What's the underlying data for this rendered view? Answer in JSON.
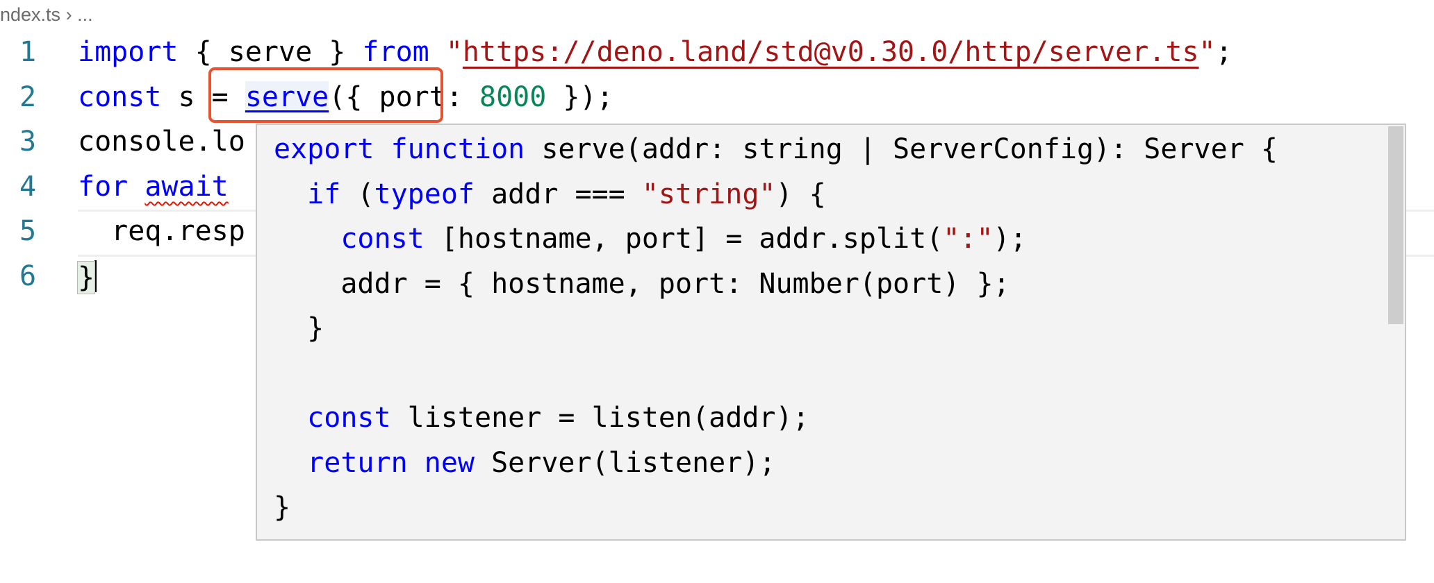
{
  "breadcrumb": {
    "file": "ndex.ts",
    "separator": "›",
    "more": "..."
  },
  "editor": {
    "line_numbers": [
      "1",
      "2",
      "3",
      "4",
      "5",
      "6"
    ],
    "lines": {
      "l1": {
        "kw1": "import",
        "t1": " { serve } ",
        "kw2": "from",
        "t2": " ",
        "q1": "\"",
        "url": "https://deno.land/std@v0.30.0/http/server.ts",
        "q2": "\"",
        "t3": ";"
      },
      "l2": {
        "kw1": "const",
        "t1": " s = ",
        "link": "serve",
        "t2": "({ port: ",
        "num": "8000",
        "t3": " });"
      },
      "l3": {
        "t1": "console.lo"
      },
      "l4": {
        "kw1": "for",
        "t1": " ",
        "kw2": "await",
        "t2": " "
      },
      "l5": {
        "t1": "  req.resp"
      },
      "l6": {
        "brace": "}"
      }
    }
  },
  "hover": {
    "lines": {
      "p1": {
        "kw1": "export",
        "t0": " ",
        "kw2": "function",
        "t1": " serve(addr: string | ServerConfig): Server {"
      },
      "p2": {
        "t0": "  ",
        "kw1": "if",
        "t1": " (",
        "kw2": "typeof",
        "t2": " addr === ",
        "str": "\"string\"",
        "t3": ") {"
      },
      "p3": {
        "t0": "    ",
        "kw1": "const",
        "t1": " [hostname, port] = addr.split(",
        "str": "\":\"",
        "t2": ");"
      },
      "p4": {
        "t1": "    addr = { hostname, port: Number(port) };"
      },
      "p5": {
        "t1": "  }"
      },
      "p7": {
        "t0": "  ",
        "kw1": "const",
        "t1": " listener = listen(addr);"
      },
      "p8": {
        "t0": "  ",
        "kw1": "return",
        "t1": " ",
        "kw2": "new",
        "t2": " Server(listener);"
      },
      "p9": {
        "t1": "}"
      }
    }
  },
  "colors": {
    "keyword": "#0000ff",
    "string": "#a31515",
    "number": "#098658",
    "line_number": "#237893",
    "highlight_box": "#e8522f"
  }
}
